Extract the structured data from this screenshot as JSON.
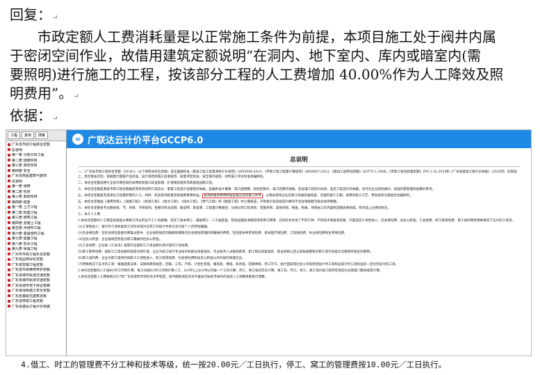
{
  "doc": {
    "reply_label": "回复：",
    "para": [
      "市政定额人工费消耗量是以正常施工条件为前提，本项目施工处于阀井内属",
      "于密闭空间作业，故借用建筑定额说明“在洞内、地下室内、库内或暗室内(需",
      "要照明)进行施工的工程，按该部分工程的人工费增加 40.00%作为人工降效及照",
      "明费用”。"
    ],
    "basis_label": "依据：",
    "mark": "↵"
  },
  "screenshot": {
    "tree_tabs": [
      "工程",
      "复用",
      "搜索"
    ],
    "tree_items": [
      "广东省市政工程综合定额",
      "总说明",
      "第一册 分部分项工程",
      "第二册 措施项目",
      "第三册 其他项目",
      "第四册 安全",
      "广东省房屋建筑与装饰",
      "总说明",
      "第一册 通用",
      "第二册 项目",
      "第三册 其他项目",
      "第四册 税金",
      "第一册 土方工程",
      "第二册 桩基工程",
      "第三册 砌筑工程",
      "第四册 混凝土工程",
      "第五册 木结构工程",
      "第六册 金属结构工程",
      "第七册 屋面工程",
      "第八册 防水工程",
      "第九册 保温工程",
      "广州市市政工程补充定额",
      "广东省园林绿化定额",
      "广东省安装工程定额",
      "广东省市政维修养护定额",
      "广东省城市轨道交通定额",
      "广东省城市轨道交通定额",
      "广东省城市地下综合管廊",
      "广东省绿色施工安全定额",
      "广东省装配式建筑定额",
      "广东省修缮工程定额",
      "广东省建设工程计价依据"
    ],
    "banner_title": "广联达云计价平台GCCP6.0",
    "content_title": "总说明",
    "paragraphs": [
      "一、《广东省市政工程综合定额（2018）》（以下简称本综合定额）是在国家标准《建设工程工程量清单计价规范》GB50500-2013、《市政工程工程量计算规范》GB50857-2013、《建设工程劳动定额》LD/T75.1-2008、《市政工程消耗量定额》ZYA 1-31-2015和《广东省建设工程计价依据》（2010年）的基础上，结合我省实际，根据我行国家产品标准、设计规范和施工验收规范、质量评定标准、安全操作规程、绿色施工评价标准等编制的。",
      "二、本综合定额适用于全省行政区域内采用修改施工标准新建、扩建和改建的市政基础设施工程。",
      "三、本综合定额是我省市政工程合理确定和有效控制工程造价、衡量工程造价合理性的依据，是编审设计概算、施工图预算、招标控制价、竣工结算的依据，是处理工程造价纠纷、鉴定工程造价的依据，也作为企业投标报价、加强内部管理和核算的参考。",
      "四、本综合定额是按正常的施工条件，目前多数企业施工机械装备程度、合理的施工工期、采用修改施工标准的施工工艺、劳动组织为基础编制的，反映了社会平均水平。",
      "五、本综合定额由《通用项目》、《道路工程》、《桥涵工程》、《给水工程》、《排水工程》、《燃气工程》和《隧道工程》共七册组成，子目套价及其组成价格均不包含增值税可抵扣进项税额。",
      "六、本综合定额各专业册按章、节、项目、子目排列。各册均有总说明、册说明、章说明、工程量计算规则、分部分项工程项目、措施项目、其他项目、税金、附录，项目由工作内容和定额表格组成。有的加上必要的附注。",
      "七、关于人工费",
      "1.本综合定额的人工费是指直接从事施工作业的生产工人的薪酬，包括了基本用工、辅助用工、人工幅度差、现场运输及清理现场等用工费用，已经综合考虑了不同工种、不同技术等级等因素，内容包括工资性收入、社会保险费、住房公积金、工会经费、职工教育经费、职工福利费及特殊情况下支付的工资等。",
      "(1)工资性收入：按计时工资标准和工作时间或对已完工作按计件单价支付给个人的劳动报酬。",
      "(2)社会保险费：在社会保险基金的筹集过程中，企业按照规定的数额和期限向社会保险管理机构缴纳的费用，包括基本养老保险费、基本医疗保险费、工伤保险费、失业保险费和生育保险费。",
      "(3)住房公积金：企业按规定标准为职工缴纳的住房公积金。",
      "(4)工会经费：企业按《工会法》规定的全部职工工资总额比例计提的工会经费。",
      "(5)职工教育经费：按职工工资总额的规定比例计提，企业为职工进行专业技术和职业技能培训，专业技术人员继续教育、职工职业技能鉴定、职业资格认定以及根据需要对职工进行各类文化教育所发生的费用。",
      "(6)职工福利费：企业为职工提供的除职工工资性收入、职工教育经费、社会保险费和住房公积金以外的福利待遇支出。",
      "(7)特殊情况下支付的工资：根据国家法律、法规和政策规定，因病、工伤、产假、计划生育假、婚丧假、事假、探亲假、定期休假、停工学习、执行国家或社会义务等原因按计时工资标准或计时工资标准的一定比例支付的工资。",
      "2.本综合定额的人工按8小时工作制计算，每工日按8小时工作制计算人工，4小时以上8小时以内按一个工日计算；停工、窝工按日历天计算，每工日、时工、停工、窝工单价按工程所在地造价主管部门相关规定计算。",
      "3.本综合定额人工费按照2017年广东省建筑市场综合水平取定，各时期各地区的水平差异可按各市发布的动态人工调整系数进行调整。"
    ],
    "highlight_before": "五、本综合定额是完成单位工程量所需的人工、材料、机具等消耗量及管理费费用标准，",
    "highlight": "该消耗量及费用标准是按正常的施工条件",
    "highlight_after": "，以我省建筑企业的施工机械装备程度、合理的施工工期、采用的施工工艺、劳动组织为基础综合编制的。"
  },
  "footer": "4.借工、时工的管理费不分工种和技术等级，统一按20.00元／工日执行，停工、窝工的管理费按10.00元／工日执行。"
}
